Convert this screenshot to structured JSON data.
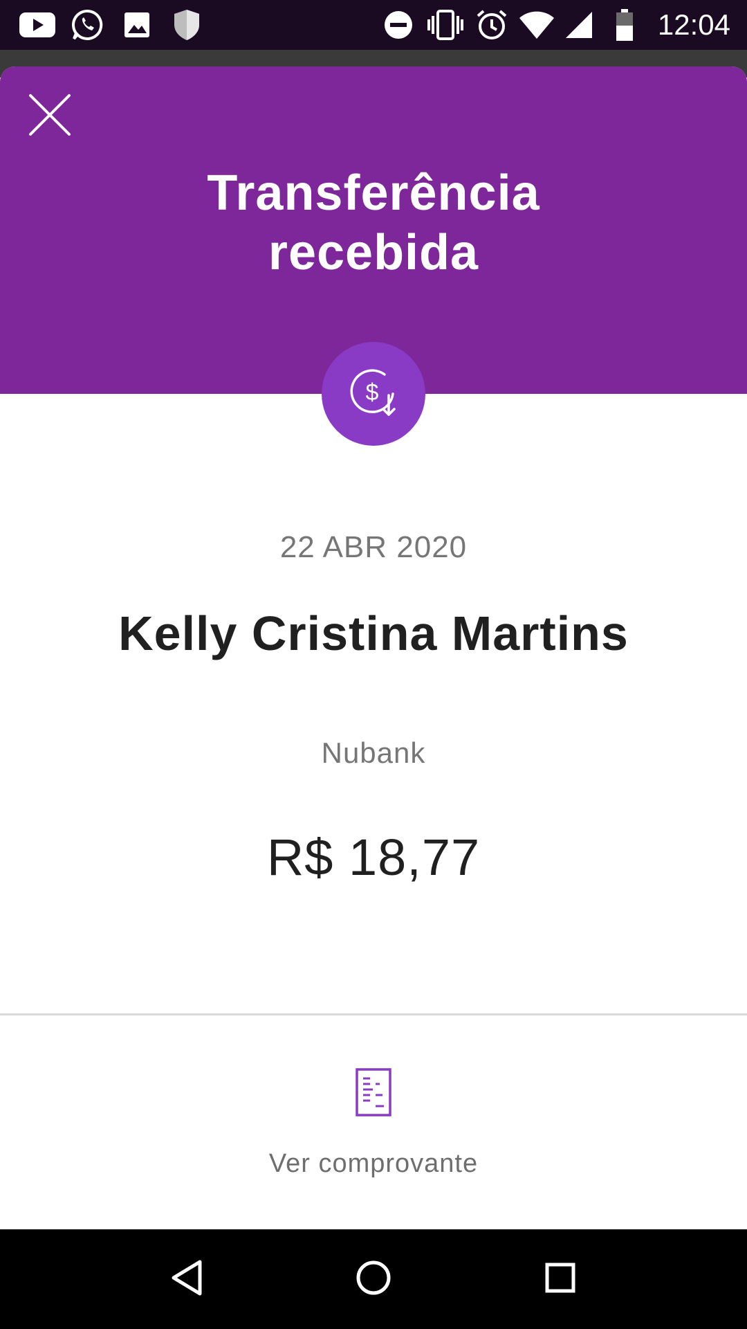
{
  "status_bar": {
    "time": "12:04",
    "left_icons": [
      "youtube-icon",
      "whatsapp-icon",
      "gallery-icon",
      "shield-icon"
    ],
    "right_icons": [
      "do-not-disturb-icon",
      "vibrate-icon",
      "alarm-icon",
      "wifi-icon",
      "cell-signal-icon",
      "battery-icon"
    ]
  },
  "header": {
    "title": "Transferência recebida",
    "close_icon": "close-icon",
    "background_color": "#7e279b"
  },
  "badge": {
    "icon": "money-received-icon",
    "color": "#8a3bc6"
  },
  "transfer": {
    "date": "22 ABR 2020",
    "sender_name": "Kelly Cristina Martins",
    "bank": "Nubank",
    "amount": "R$ 18,77"
  },
  "receipt": {
    "icon": "receipt-icon",
    "label": "Ver comprovante"
  },
  "nav_bar": {
    "buttons": [
      "back-icon",
      "home-icon",
      "recents-icon"
    ]
  }
}
